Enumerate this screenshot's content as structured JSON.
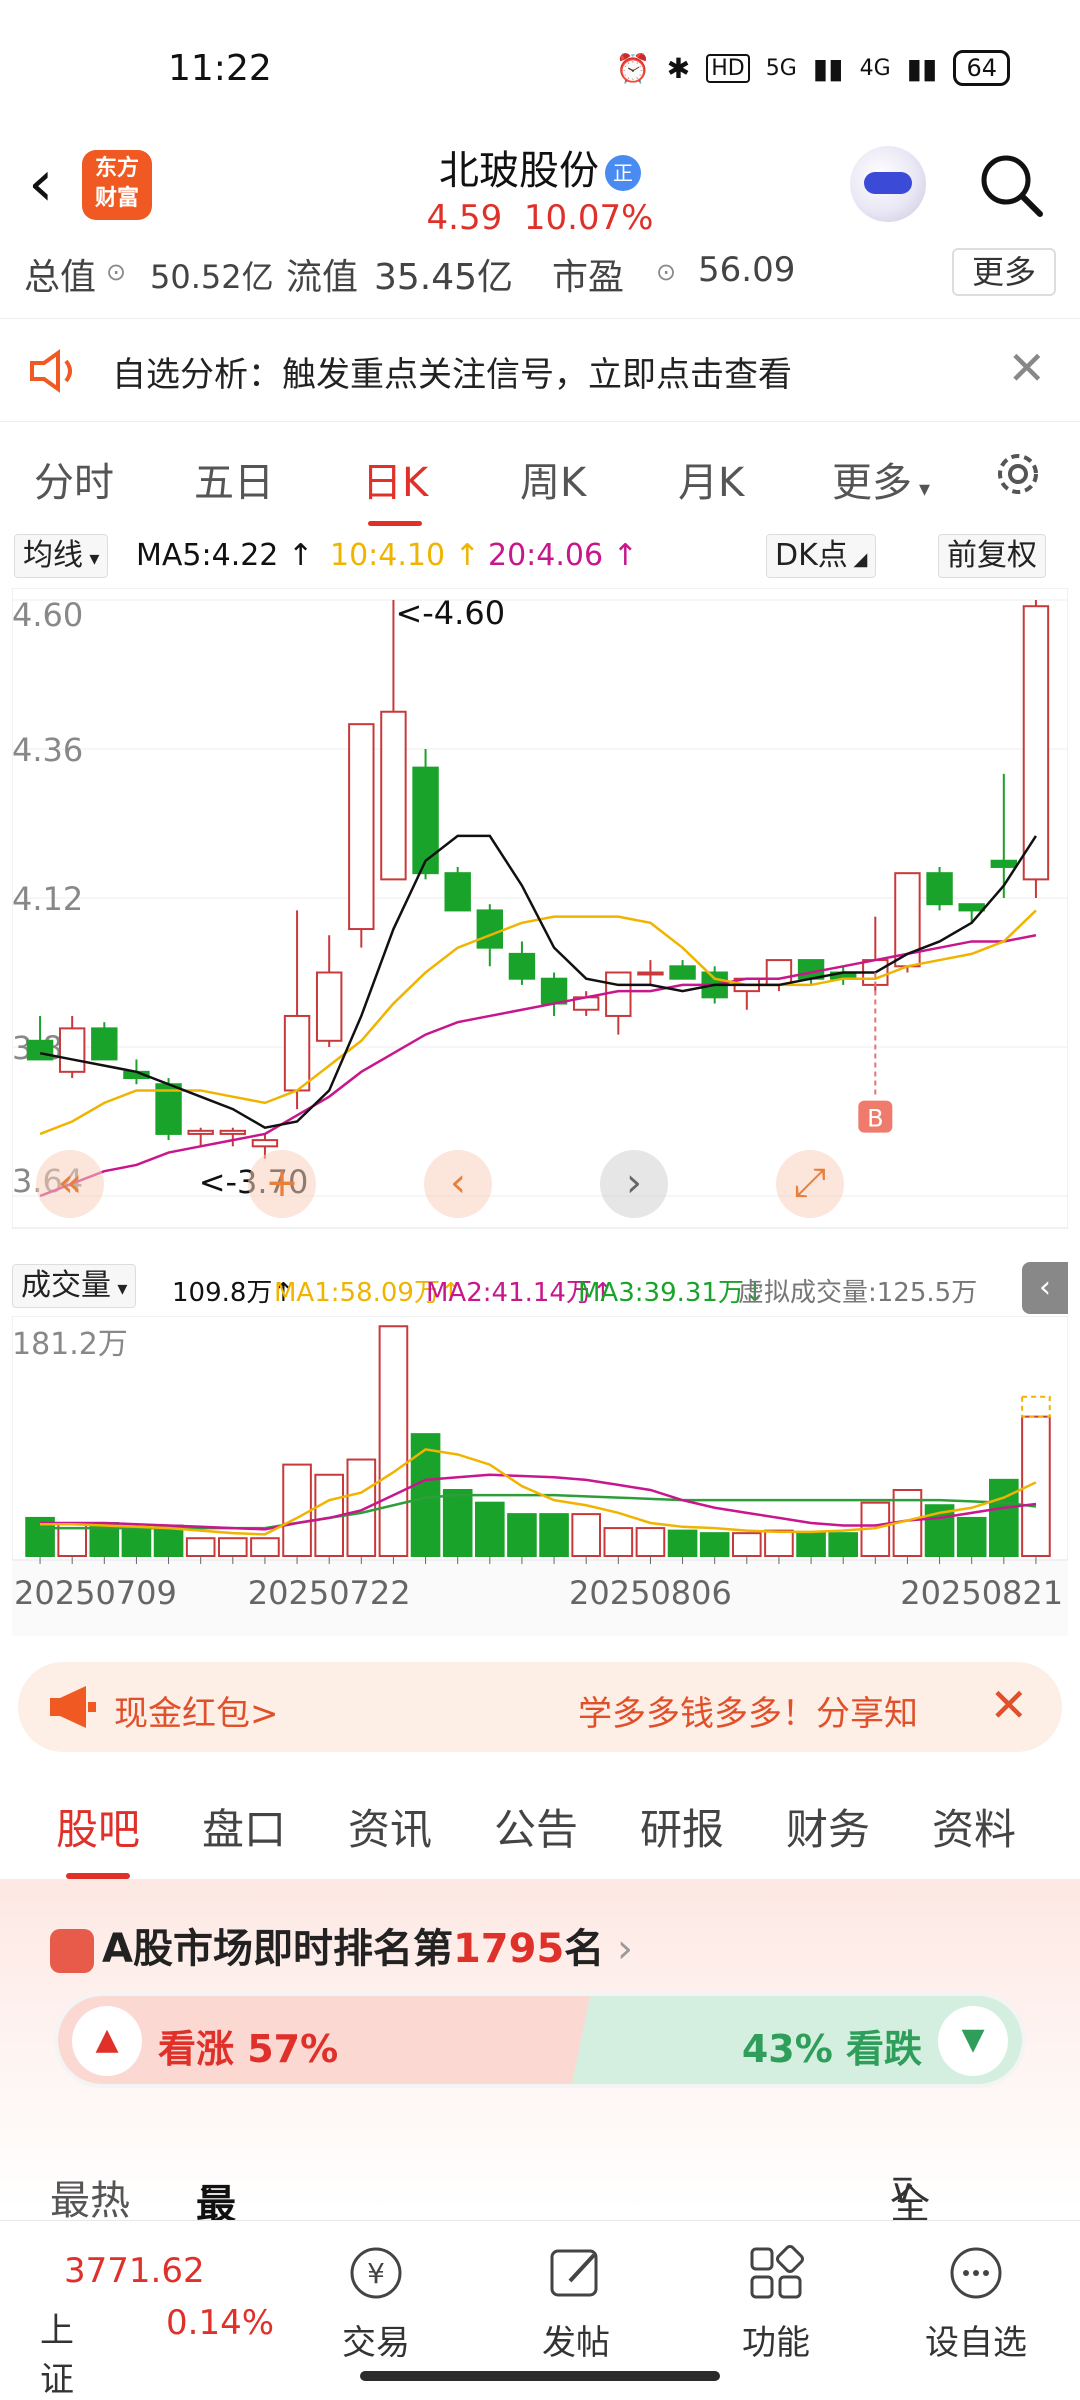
{
  "status": {
    "time": "11:22",
    "hd": "HD",
    "net1": "5G",
    "net2": "4G",
    "battery": "64"
  },
  "header": {
    "logo": "东方\n财富",
    "title": "北玻股份",
    "badge": "正",
    "price": "4.59",
    "change_pct": "10.07%"
  },
  "valuebar": {
    "total_label": "总值",
    "total_value": "50.52亿",
    "float_label": "流值",
    "float_value": "35.45亿",
    "pe_label": "市盈",
    "pe_value": "56.09",
    "more": "更多"
  },
  "notice": {
    "text": "自选分析：触发重点关注信号，立即点击查看"
  },
  "chart_tabs": [
    "分时",
    "五日",
    "日K",
    "周K",
    "月K",
    "更多"
  ],
  "ma": {
    "selector": "均线",
    "ma5": "MA5:4.22",
    "ma10": "10:4.10",
    "ma20": "20:4.06",
    "dk": "DK点",
    "fq": "前复权",
    "colors": {
      "ma5": "#111111",
      "ma10": "#f0b400",
      "ma20": "#c8168c",
      "up": "#c8393b",
      "down": "#1aa32a"
    }
  },
  "kline_labels": {
    "max": "<-4.60",
    "min": "<-3.70",
    "b_marker": "B"
  },
  "volume": {
    "selector": "成交量",
    "vol": "109.8万",
    "ma1": "MA1:58.09万",
    "ma2": "MA2:41.14万",
    "ma3": "MA3:39.31万",
    "virtual": "虚拟成交量:125.5万"
  },
  "chart_data": {
    "type": "candlestick",
    "ylim": [
      3.64,
      4.6
    ],
    "y_ticks": [
      "4.60",
      "4.36",
      "4.12",
      "3.88",
      "3.64"
    ],
    "x_ticks": [
      "20250709",
      "20250722",
      "20250806",
      "20250821"
    ],
    "candles": [
      {
        "o": 3.89,
        "h": 3.93,
        "l": 3.86,
        "c": 3.86
      },
      {
        "o": 3.84,
        "h": 3.93,
        "l": 3.83,
        "c": 3.91
      },
      {
        "o": 3.91,
        "h": 3.92,
        "l": 3.86,
        "c": 3.86
      },
      {
        "o": 3.84,
        "h": 3.86,
        "l": 3.82,
        "c": 3.83
      },
      {
        "o": 3.82,
        "h": 3.83,
        "l": 3.73,
        "c": 3.74
      },
      {
        "o": 3.74,
        "h": 3.75,
        "l": 3.72,
        "c": 3.745
      },
      {
        "o": 3.74,
        "h": 3.75,
        "l": 3.72,
        "c": 3.745
      },
      {
        "o": 3.72,
        "h": 3.74,
        "l": 3.7,
        "c": 3.73
      },
      {
        "o": 3.81,
        "h": 4.1,
        "l": 3.78,
        "c": 3.93
      },
      {
        "o": 3.89,
        "h": 4.06,
        "l": 3.88,
        "c": 4.0
      },
      {
        "o": 4.07,
        "h": 4.4,
        "l": 4.04,
        "c": 4.4
      },
      {
        "o": 4.15,
        "h": 4.6,
        "l": 4.15,
        "c": 4.42
      },
      {
        "o": 4.33,
        "h": 4.36,
        "l": 4.15,
        "c": 4.16
      },
      {
        "o": 4.16,
        "h": 4.17,
        "l": 4.1,
        "c": 4.1
      },
      {
        "o": 4.1,
        "h": 4.11,
        "l": 4.01,
        "c": 4.04
      },
      {
        "o": 4.03,
        "h": 4.05,
        "l": 3.98,
        "c": 3.99
      },
      {
        "o": 3.99,
        "h": 4.0,
        "l": 3.93,
        "c": 3.95
      },
      {
        "o": 3.94,
        "h": 3.97,
        "l": 3.93,
        "c": 3.96
      },
      {
        "o": 3.93,
        "h": 4.0,
        "l": 3.9,
        "c": 4.0
      },
      {
        "o": 4.0,
        "h": 4.02,
        "l": 3.98,
        "c": 4.0
      },
      {
        "o": 4.01,
        "h": 4.02,
        "l": 3.99,
        "c": 3.99
      },
      {
        "o": 4.0,
        "h": 4.01,
        "l": 3.95,
        "c": 3.96
      },
      {
        "o": 3.97,
        "h": 3.99,
        "l": 3.94,
        "c": 3.99
      },
      {
        "o": 3.98,
        "h": 4.02,
        "l": 3.97,
        "c": 4.02
      },
      {
        "o": 4.02,
        "h": 4.02,
        "l": 3.98,
        "c": 3.99
      },
      {
        "o": 4.0,
        "h": 4.01,
        "l": 3.98,
        "c": 3.99
      },
      {
        "o": 3.98,
        "h": 4.09,
        "l": 3.97,
        "c": 4.02
      },
      {
        "o": 4.01,
        "h": 4.03,
        "l": 4.0,
        "c": 4.16
      },
      {
        "o": 4.16,
        "h": 4.17,
        "l": 4.1,
        "c": 4.11
      },
      {
        "o": 4.11,
        "h": 4.11,
        "l": 4.08,
        "c": 4.1
      },
      {
        "o": 4.18,
        "h": 4.32,
        "l": 4.12,
        "c": 4.17
      },
      {
        "o": 4.15,
        "h": 4.6,
        "l": 4.12,
        "c": 4.59
      }
    ],
    "ma5": [
      3.87,
      3.86,
      3.85,
      3.84,
      3.82,
      3.8,
      3.78,
      3.75,
      3.76,
      3.81,
      3.93,
      4.07,
      4.18,
      4.22,
      4.22,
      4.14,
      4.04,
      3.99,
      3.98,
      3.98,
      3.97,
      3.98,
      3.98,
      3.98,
      3.99,
      4.0,
      4.0,
      4.03,
      4.05,
      4.08,
      4.14,
      4.22
    ],
    "ma10": [
      3.74,
      3.76,
      3.79,
      3.81,
      3.81,
      3.81,
      3.8,
      3.79,
      3.81,
      3.85,
      3.89,
      3.95,
      4.0,
      4.04,
      4.06,
      4.08,
      4.09,
      4.09,
      4.09,
      4.08,
      4.04,
      3.99,
      3.98,
      3.98,
      3.98,
      3.99,
      3.99,
      4.01,
      4.02,
      4.03,
      4.05,
      4.1
    ],
    "ma20": [
      3.64,
      3.66,
      3.68,
      3.69,
      3.71,
      3.72,
      3.73,
      3.74,
      3.77,
      3.8,
      3.84,
      3.87,
      3.9,
      3.92,
      3.93,
      3.94,
      3.95,
      3.96,
      3.97,
      3.97,
      3.98,
      3.98,
      3.99,
      3.99,
      4.0,
      4.01,
      4.02,
      4.03,
      4.04,
      4.05,
      4.05,
      4.06
    ],
    "volume_ylim": [
      0,
      181.2
    ],
    "volume_ylabel": "181.2万",
    "volumes": [
      30,
      26,
      26,
      22,
      24,
      14,
      14,
      14,
      72,
      64,
      76,
      181,
      96,
      52,
      42,
      33,
      33,
      33,
      22,
      22,
      20,
      18,
      18,
      20,
      18,
      18,
      42,
      52,
      40,
      30,
      60,
      109.8
    ],
    "vol_ma1": [
      25,
      25,
      24,
      23,
      22,
      20,
      18,
      17,
      30,
      44,
      50,
      66,
      84,
      80,
      72,
      55,
      44,
      40,
      34,
      26,
      23,
      22,
      20,
      19,
      19,
      20,
      22,
      28,
      34,
      38,
      46,
      58
    ],
    "vol_ma2": [
      26,
      26,
      26,
      25,
      24,
      23,
      22,
      21,
      26,
      30,
      36,
      48,
      60,
      62,
      64,
      63,
      62,
      60,
      56,
      52,
      44,
      38,
      34,
      30,
      26,
      24,
      24,
      28,
      30,
      34,
      38,
      41
    ],
    "vol_ma3": [
      22,
      22,
      22,
      22,
      22,
      22,
      22,
      22,
      26,
      30,
      34,
      40,
      46,
      48,
      48,
      48,
      48,
      47,
      46,
      45,
      44,
      44,
      44,
      44,
      44,
      44,
      44,
      44,
      44,
      43,
      42,
      39
    ]
  },
  "banner": {
    "left": "现金红包>",
    "right": "学多多钱多多！分享知"
  },
  "sub_tabs": [
    "股吧",
    "盘口",
    "资讯",
    "公告",
    "研报",
    "财务",
    "资料"
  ],
  "rank": {
    "prefix": "A股市场即时排名第",
    "num": "1795",
    "suffix": "名",
    "up": "看涨 57%",
    "down": "43% 看跌"
  },
  "sort": {
    "hot": "最热",
    "newest": "最新",
    "all": "全部"
  },
  "bottom": {
    "index_value": "3771.62",
    "index_name": "上证",
    "index_change": "0.14%",
    "items": [
      "交易",
      "发帖",
      "功能",
      "设自选"
    ]
  }
}
